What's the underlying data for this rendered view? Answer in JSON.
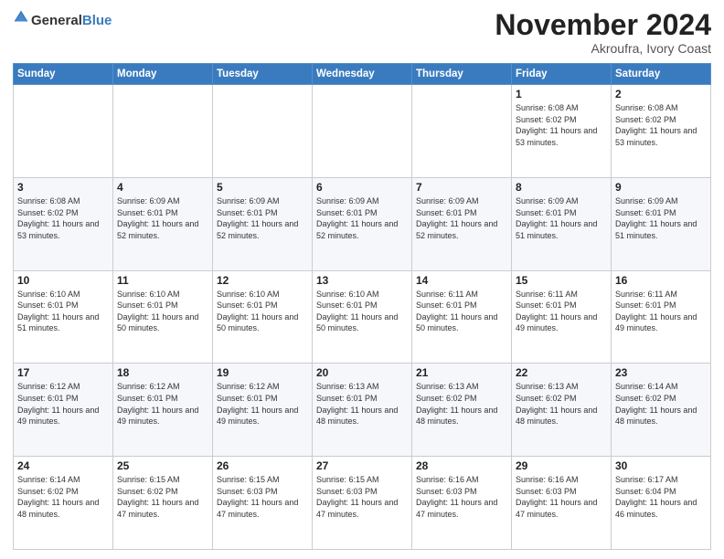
{
  "header": {
    "logo_general": "General",
    "logo_blue": "Blue",
    "month": "November 2024",
    "location": "Akroufra, Ivory Coast"
  },
  "weekdays": [
    "Sunday",
    "Monday",
    "Tuesday",
    "Wednesday",
    "Thursday",
    "Friday",
    "Saturday"
  ],
  "weeks": [
    [
      {
        "day": "",
        "sunrise": "",
        "sunset": "",
        "daylight": ""
      },
      {
        "day": "",
        "sunrise": "",
        "sunset": "",
        "daylight": ""
      },
      {
        "day": "",
        "sunrise": "",
        "sunset": "",
        "daylight": ""
      },
      {
        "day": "",
        "sunrise": "",
        "sunset": "",
        "daylight": ""
      },
      {
        "day": "",
        "sunrise": "",
        "sunset": "",
        "daylight": ""
      },
      {
        "day": "1",
        "sunrise": "Sunrise: 6:08 AM",
        "sunset": "Sunset: 6:02 PM",
        "daylight": "Daylight: 11 hours and 53 minutes."
      },
      {
        "day": "2",
        "sunrise": "Sunrise: 6:08 AM",
        "sunset": "Sunset: 6:02 PM",
        "daylight": "Daylight: 11 hours and 53 minutes."
      }
    ],
    [
      {
        "day": "3",
        "sunrise": "Sunrise: 6:08 AM",
        "sunset": "Sunset: 6:02 PM",
        "daylight": "Daylight: 11 hours and 53 minutes."
      },
      {
        "day": "4",
        "sunrise": "Sunrise: 6:09 AM",
        "sunset": "Sunset: 6:01 PM",
        "daylight": "Daylight: 11 hours and 52 minutes."
      },
      {
        "day": "5",
        "sunrise": "Sunrise: 6:09 AM",
        "sunset": "Sunset: 6:01 PM",
        "daylight": "Daylight: 11 hours and 52 minutes."
      },
      {
        "day": "6",
        "sunrise": "Sunrise: 6:09 AM",
        "sunset": "Sunset: 6:01 PM",
        "daylight": "Daylight: 11 hours and 52 minutes."
      },
      {
        "day": "7",
        "sunrise": "Sunrise: 6:09 AM",
        "sunset": "Sunset: 6:01 PM",
        "daylight": "Daylight: 11 hours and 52 minutes."
      },
      {
        "day": "8",
        "sunrise": "Sunrise: 6:09 AM",
        "sunset": "Sunset: 6:01 PM",
        "daylight": "Daylight: 11 hours and 51 minutes."
      },
      {
        "day": "9",
        "sunrise": "Sunrise: 6:09 AM",
        "sunset": "Sunset: 6:01 PM",
        "daylight": "Daylight: 11 hours and 51 minutes."
      }
    ],
    [
      {
        "day": "10",
        "sunrise": "Sunrise: 6:10 AM",
        "sunset": "Sunset: 6:01 PM",
        "daylight": "Daylight: 11 hours and 51 minutes."
      },
      {
        "day": "11",
        "sunrise": "Sunrise: 6:10 AM",
        "sunset": "Sunset: 6:01 PM",
        "daylight": "Daylight: 11 hours and 50 minutes."
      },
      {
        "day": "12",
        "sunrise": "Sunrise: 6:10 AM",
        "sunset": "Sunset: 6:01 PM",
        "daylight": "Daylight: 11 hours and 50 minutes."
      },
      {
        "day": "13",
        "sunrise": "Sunrise: 6:10 AM",
        "sunset": "Sunset: 6:01 PM",
        "daylight": "Daylight: 11 hours and 50 minutes."
      },
      {
        "day": "14",
        "sunrise": "Sunrise: 6:11 AM",
        "sunset": "Sunset: 6:01 PM",
        "daylight": "Daylight: 11 hours and 50 minutes."
      },
      {
        "day": "15",
        "sunrise": "Sunrise: 6:11 AM",
        "sunset": "Sunset: 6:01 PM",
        "daylight": "Daylight: 11 hours and 49 minutes."
      },
      {
        "day": "16",
        "sunrise": "Sunrise: 6:11 AM",
        "sunset": "Sunset: 6:01 PM",
        "daylight": "Daylight: 11 hours and 49 minutes."
      }
    ],
    [
      {
        "day": "17",
        "sunrise": "Sunrise: 6:12 AM",
        "sunset": "Sunset: 6:01 PM",
        "daylight": "Daylight: 11 hours and 49 minutes."
      },
      {
        "day": "18",
        "sunrise": "Sunrise: 6:12 AM",
        "sunset": "Sunset: 6:01 PM",
        "daylight": "Daylight: 11 hours and 49 minutes."
      },
      {
        "day": "19",
        "sunrise": "Sunrise: 6:12 AM",
        "sunset": "Sunset: 6:01 PM",
        "daylight": "Daylight: 11 hours and 49 minutes."
      },
      {
        "day": "20",
        "sunrise": "Sunrise: 6:13 AM",
        "sunset": "Sunset: 6:01 PM",
        "daylight": "Daylight: 11 hours and 48 minutes."
      },
      {
        "day": "21",
        "sunrise": "Sunrise: 6:13 AM",
        "sunset": "Sunset: 6:02 PM",
        "daylight": "Daylight: 11 hours and 48 minutes."
      },
      {
        "day": "22",
        "sunrise": "Sunrise: 6:13 AM",
        "sunset": "Sunset: 6:02 PM",
        "daylight": "Daylight: 11 hours and 48 minutes."
      },
      {
        "day": "23",
        "sunrise": "Sunrise: 6:14 AM",
        "sunset": "Sunset: 6:02 PM",
        "daylight": "Daylight: 11 hours and 48 minutes."
      }
    ],
    [
      {
        "day": "24",
        "sunrise": "Sunrise: 6:14 AM",
        "sunset": "Sunset: 6:02 PM",
        "daylight": "Daylight: 11 hours and 48 minutes."
      },
      {
        "day": "25",
        "sunrise": "Sunrise: 6:15 AM",
        "sunset": "Sunset: 6:02 PM",
        "daylight": "Daylight: 11 hours and 47 minutes."
      },
      {
        "day": "26",
        "sunrise": "Sunrise: 6:15 AM",
        "sunset": "Sunset: 6:03 PM",
        "daylight": "Daylight: 11 hours and 47 minutes."
      },
      {
        "day": "27",
        "sunrise": "Sunrise: 6:15 AM",
        "sunset": "Sunset: 6:03 PM",
        "daylight": "Daylight: 11 hours and 47 minutes."
      },
      {
        "day": "28",
        "sunrise": "Sunrise: 6:16 AM",
        "sunset": "Sunset: 6:03 PM",
        "daylight": "Daylight: 11 hours and 47 minutes."
      },
      {
        "day": "29",
        "sunrise": "Sunrise: 6:16 AM",
        "sunset": "Sunset: 6:03 PM",
        "daylight": "Daylight: 11 hours and 47 minutes."
      },
      {
        "day": "30",
        "sunrise": "Sunrise: 6:17 AM",
        "sunset": "Sunset: 6:04 PM",
        "daylight": "Daylight: 11 hours and 46 minutes."
      }
    ]
  ]
}
